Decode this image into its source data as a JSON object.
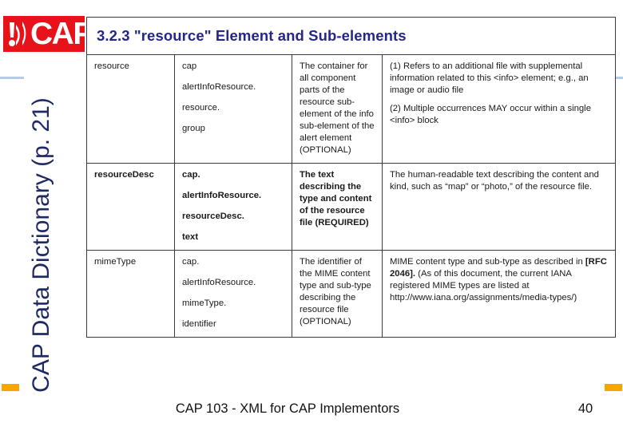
{
  "slide": {
    "side_title": "CAP Data Dictionary (p. 21)",
    "logo": {
      "text": "CAP",
      "icon": "broadcast-alert-icon",
      "background_color": "#e8121a",
      "text_color": "#ffffff"
    },
    "accent_colors": {
      "header_blue": "#25268c",
      "side_title_blue": "#1f2a63",
      "rule_blue": "#b8cbe4",
      "marker_orange": "#f5a700",
      "logo_red": "#e8121a"
    }
  },
  "table": {
    "header": "3.2.3 \"resource\" Element and Sub-elements",
    "rows": [
      {
        "name": "resource",
        "bold": false,
        "path": [
          "cap",
          "alertInfoResource.",
          "resource.",
          "group"
        ],
        "description": "The container for all component parts of the resource sub-element of the info sub-element of the alert element (OPTIONAL)",
        "notes": [
          "(1) Refers to an additional file with supplemental information related to this <info> element; e.g., an image or audio file",
          "(2) Multiple occurrences MAY occur within a single <info> block"
        ]
      },
      {
        "name": "resourceDesc",
        "bold": true,
        "path": [
          "cap.",
          "alertInfoResource.",
          "resourceDesc.",
          "text"
        ],
        "description": "The text describing the type and content of the resource file (REQUIRED)",
        "notes": [
          "The human-readable text describing the content and kind, such as “map” or “photo,” of the resource file."
        ]
      },
      {
        "name": "mimeType",
        "bold": false,
        "path": [
          "cap.",
          "alertInfoResource.",
          "mimeType.",
          "identifier"
        ],
        "description": "The identifier of the MIME content type and sub-type describing the resource file (OPTIONAL)",
        "notes_rich": {
          "before": "MIME content type and sub-type as described in ",
          "emphasis": "[RFC 2046].",
          "after": " (As of this document, the current IANA registered MIME types are listed at http://www.iana.org/assignments/media-types/)"
        }
      }
    ]
  },
  "footer": {
    "title": "CAP 103 - XML for CAP Implementors",
    "page_number": "40"
  }
}
